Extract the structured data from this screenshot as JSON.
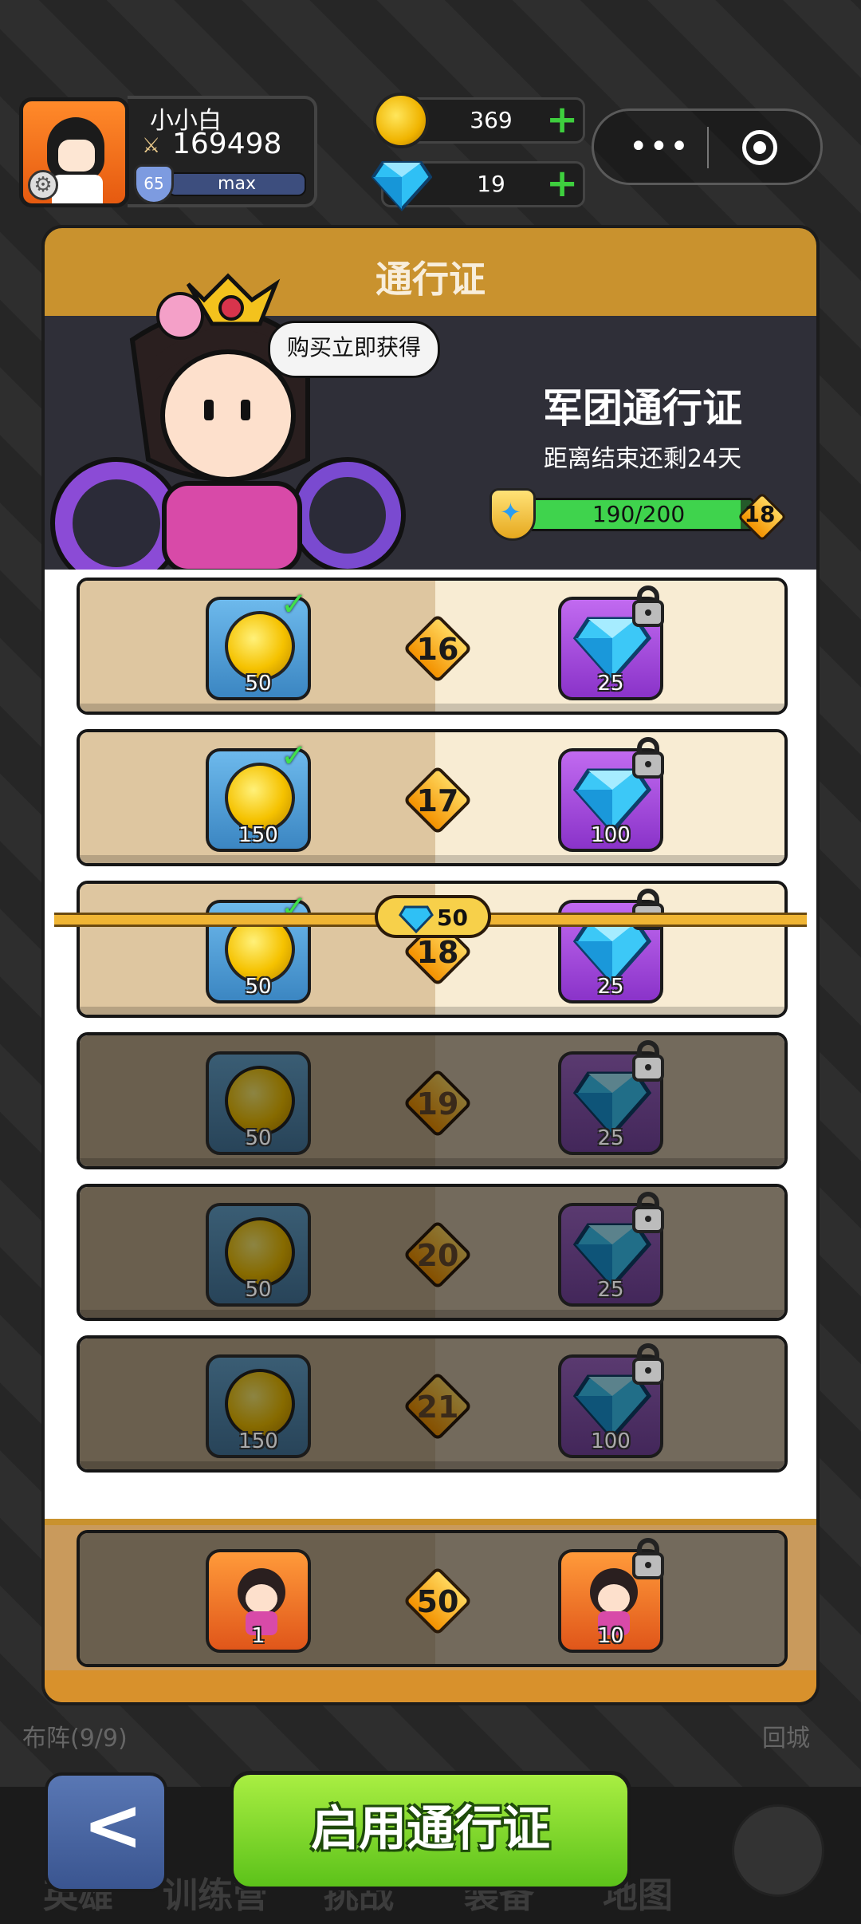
{
  "player": {
    "name": "小小白",
    "power": "169498",
    "level": "65",
    "exp_label": "max"
  },
  "resources": {
    "coins": "369",
    "gems": "19",
    "plus": "+"
  },
  "menu": {
    "dots": "•••"
  },
  "panel": {
    "title": "通行证",
    "bubble": "购买立即获得",
    "pass_name": "军团通行证",
    "remaining": "距离结束还剩24天",
    "progress_text": "190/200",
    "progress": 0.95,
    "current_level": "18"
  },
  "rows": [
    {
      "level": "16",
      "free_amount": "50",
      "prem_amount": "25",
      "unlocked": true
    },
    {
      "level": "17",
      "free_amount": "150",
      "prem_amount": "100",
      "unlocked": true
    },
    {
      "level": "18",
      "free_amount": "50",
      "prem_amount": "25",
      "unlocked": true
    },
    {
      "level": "19",
      "free_amount": "50",
      "prem_amount": "25",
      "unlocked": false
    },
    {
      "level": "20",
      "free_amount": "50",
      "prem_amount": "25",
      "unlocked": false
    },
    {
      "level": "21",
      "free_amount": "150",
      "prem_amount": "100",
      "unlocked": false
    }
  ],
  "unlock_cost": "50",
  "final_row": {
    "level": "50",
    "free_amount": "1",
    "prem_amount": "10"
  },
  "buttons": {
    "back": "<",
    "activate": "启用通行证"
  },
  "bg_labels": {
    "formation": "布阵(9/9)",
    "return_city": "回城"
  },
  "nav": [
    "英雄",
    "训练营",
    "挑战",
    "装备",
    "地图"
  ],
  "colors": {
    "accent_green": "#5cc21a",
    "panel_gold": "#c9922e"
  }
}
